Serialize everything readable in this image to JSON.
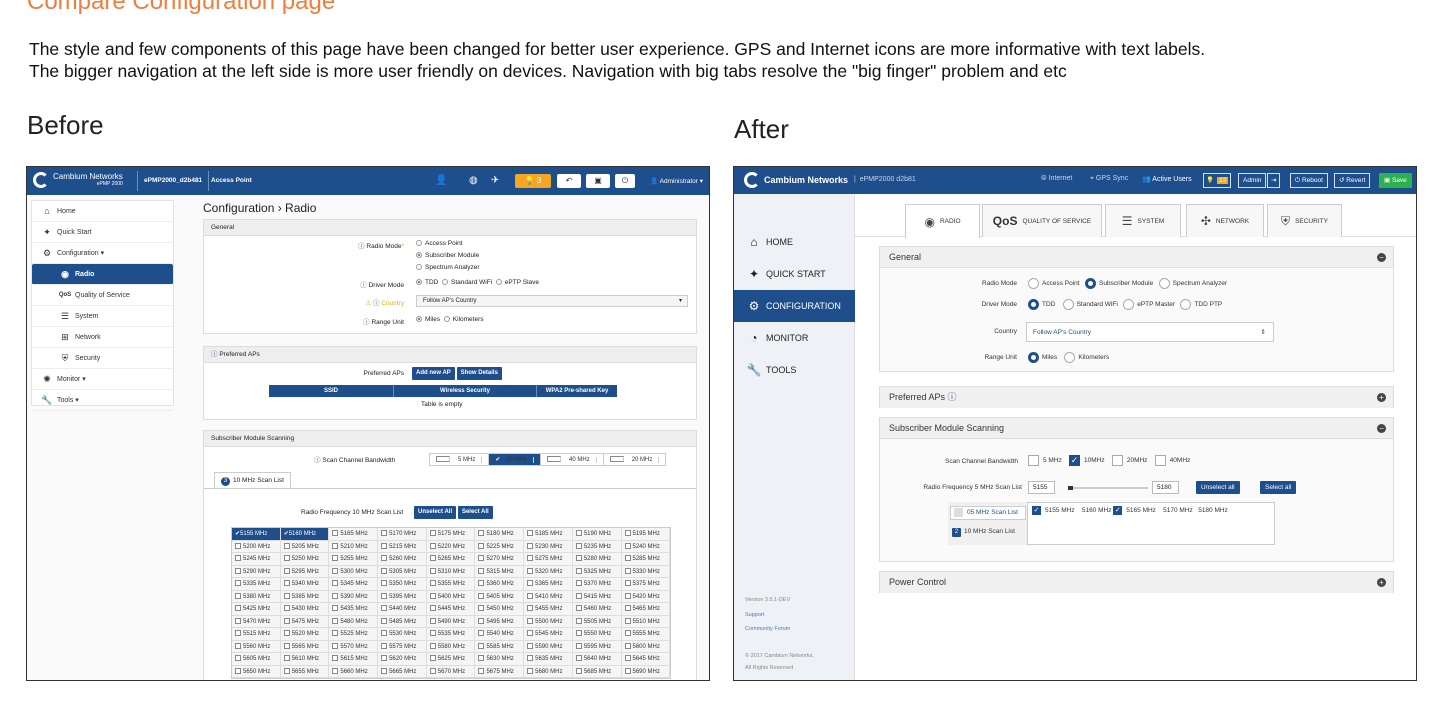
{
  "header": {
    "title": "Compare Configuration page",
    "intro_line1": "The style and few components of this page have been changed for better user experience. GPS and Internet icons are more informative with text labels.",
    "intro_line2": "The bigger navigation at the left side is more user friendly on devices. Navigation with big tabs resolve the \"big finger\" problem and etc",
    "before_label": "Before",
    "after_label": "After"
  },
  "colors": {
    "accent": "#1e4e8c",
    "title": "#f07d3c",
    "warning": "#f5a623"
  },
  "before": {
    "brand": "Cambium Networks",
    "brand_sub": "ePMP 2000",
    "device": "ePMP2000_d2b481",
    "mode": "Access Point",
    "admin": "Administrator",
    "warn_count": "3",
    "nav": [
      {
        "label": "Home",
        "icon": "home-icon"
      },
      {
        "label": "Quick Start",
        "icon": "wizard-icon"
      },
      {
        "label": "Configuration",
        "icon": "gear-icon"
      },
      {
        "label": "Radio",
        "icon": "radio-icon"
      },
      {
        "label": "Quality of Service",
        "icon": "qos-icon"
      },
      {
        "label": "System",
        "icon": "system-icon"
      },
      {
        "label": "Network",
        "icon": "network-icon"
      },
      {
        "label": "Security",
        "icon": "shield-icon"
      },
      {
        "label": "Monitor",
        "icon": "monitor-icon"
      },
      {
        "label": "Tools",
        "icon": "wrench-icon"
      }
    ],
    "page_heading": "Configuration › Radio",
    "general": {
      "title": "General",
      "radio_mode_label": "Radio Mode",
      "radio_modes": [
        "Access Point",
        "Subscriber Module",
        "Spectrum Analyzer"
      ],
      "driver_mode_label": "Driver Mode",
      "driver_modes": [
        "TDD",
        "Standard WiFi",
        "ePTP Slave"
      ],
      "country_label": "Country",
      "country_value": "Follow AP's Country",
      "range_unit_label": "Range Unit",
      "range_units": [
        "Miles",
        "Kilometers"
      ]
    },
    "preferred": {
      "title": "Preferred APs",
      "label": "Preferred APs",
      "add_btn": "Add new AP",
      "details_btn": "Show Details",
      "columns": [
        "SSID",
        "Wireless Security",
        "WPA2 Pre-shared Key"
      ],
      "empty": "Table is empty"
    },
    "scanning": {
      "title": "Subscriber Module Scanning",
      "bw_label": "Scan Channel Bandwidth",
      "bw_options": [
        "5 MHz",
        "10 MHz",
        "40 MHz",
        "20 MHz"
      ],
      "tab_label": "10 MHz Scan List",
      "tab_badge": "3",
      "freq_label": "Radio Frequency 10 MHz Scan List",
      "unselect_btn": "Unselect All",
      "select_btn": "Select All"
    }
  },
  "after": {
    "brand": "Cambium Networks",
    "device": "ePMP2000 d2b81",
    "internet": "Internet",
    "gps": "GPS Sync",
    "users": "Active Users",
    "warn_count": "12",
    "admin": "Admin",
    "reboot": "Reboot",
    "revert": "Revert",
    "save": "Save",
    "nav": [
      {
        "label": "HOME",
        "icon": "home-icon"
      },
      {
        "label": "QUICK START",
        "icon": "wizard-icon"
      },
      {
        "label": "CONFIGURATION",
        "icon": "gear-icon"
      },
      {
        "label": "MONITOR",
        "icon": "dashboard-icon"
      },
      {
        "label": "TOOLS",
        "icon": "wrench-icon"
      }
    ],
    "version": "Version 3.5.1-DEV",
    "support": "Support",
    "forum": "Community Forum",
    "copyright": "© 2017 Cambium Networks,",
    "rights": "All Rights Reserved",
    "tabs": [
      {
        "label": "RADIO",
        "icon": "radio-icon"
      },
      {
        "label": "QUALITY OF SERVICE",
        "icon": "qos-icon",
        "prefix": "QoS"
      },
      {
        "label": "SYSTEM",
        "icon": "system-icon"
      },
      {
        "label": "NETWORK",
        "icon": "network-icon"
      },
      {
        "label": "SECURITY",
        "icon": "shield-icon"
      }
    ],
    "general": {
      "title": "General",
      "radio_mode_label": "Radio Mode",
      "radio_modes": [
        "Access Point",
        "Subscriber Module",
        "Spectrum Analyzer"
      ],
      "driver_mode_label": "Driver Mode",
      "driver_modes": [
        "TDD",
        "Standard WiFi",
        "ePTP Master",
        "TDD PTP"
      ],
      "country_label": "Country",
      "country_value": "Follow AP's Country",
      "range_unit_label": "Range Unit",
      "range_units": [
        "Miles",
        "Kilometers"
      ]
    },
    "preferred_title": "Preferred APs",
    "scanning": {
      "title": "Subscriber Module Scanning",
      "bw_label": "Scan Channel Bandwidth",
      "bw_options": [
        "5 MHz",
        "10MHz",
        "20MHz",
        "40MHz"
      ],
      "freq_label": "Radio Frequency 5 MHz Scan List",
      "range_min": "5155",
      "range_max": "5180",
      "unselect_btn": "Unselect all",
      "select_btn": "Select all",
      "list5": "05 MHz Scan List",
      "list10": "10 MHz Scan List",
      "list10_badge": "2",
      "freqs": [
        "5155 MHz",
        "5160 MHz",
        "5165 MHz",
        "5170 MHz",
        "5180 MHz"
      ]
    },
    "power_title": "Power Control"
  }
}
